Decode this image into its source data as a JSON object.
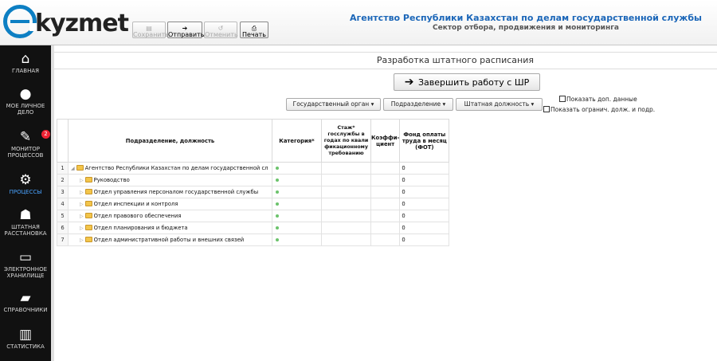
{
  "header": {
    "logo_text": "kyzmet",
    "agency_title": "Агентство Республики Казахстан по делам государственной службы",
    "agency_subtitle": "Сектор отбора, продвижения и мониторинга"
  },
  "toolbar": {
    "save_label": "Сохранить",
    "send_label": "Отправить",
    "cancel_label": "Отменить",
    "print_label": "Печать"
  },
  "sidebar": {
    "items": [
      {
        "label": "ГЛАВНАЯ",
        "icon": "home-icon"
      },
      {
        "label": "МОЕ ЛИЧНОЕ ДЕЛО",
        "icon": "user-icon"
      },
      {
        "label": "МОНИТОР ПРОЦЕССОВ",
        "icon": "edit-icon",
        "badge": "2"
      },
      {
        "label": "ПРОЦЕССЫ",
        "icon": "gears-icon",
        "active": true
      },
      {
        "label": "ШТАТНАЯ РАССТАНОВКА",
        "icon": "people-icon"
      },
      {
        "label": "ЭЛЕКТРОННОЕ ХРАНИЛИЩЕ",
        "icon": "inbox-icon"
      },
      {
        "label": "СПРАВОЧНИКИ",
        "icon": "book-icon"
      },
      {
        "label": "СТАТИСТИКА",
        "icon": "chart-icon"
      }
    ]
  },
  "main": {
    "title": "Разработка штатного расписания",
    "finish_button": "Завершить работу с ШР",
    "filters": {
      "gov_body": "Государственный орган",
      "division": "Подразделение",
      "position": "Штатная должность"
    },
    "checkboxes": {
      "show_extra": "Показать доп. данные",
      "show_restricted": "Показать огранич. долж. и подр."
    },
    "table": {
      "columns": {
        "name": "Подразделение, должность",
        "category": "Категория*",
        "experience": "Стаж* госслужбы в годах по квали фикационному требованию",
        "coef": "Коэффи- циент",
        "fot": "Фонд оплаты труда в месяц (ФОТ)"
      },
      "rows": [
        {
          "n": "1",
          "name": "Агентство Республики Казахстан по делам государственной сл",
          "fot": "0",
          "expanded": true
        },
        {
          "n": "2",
          "name": "Руководство",
          "fot": "0"
        },
        {
          "n": "3",
          "name": "Отдел управления персоналом государственной службы",
          "fot": "0"
        },
        {
          "n": "4",
          "name": "Отдел инспекции и контроля",
          "fot": "0"
        },
        {
          "n": "5",
          "name": "Отдел правового обеспечения",
          "fot": "0"
        },
        {
          "n": "6",
          "name": "Отдел планирования и бюджета",
          "fot": "0"
        },
        {
          "n": "7",
          "name": "Отдел административной работы и внешних связей",
          "fot": "0"
        }
      ]
    }
  }
}
